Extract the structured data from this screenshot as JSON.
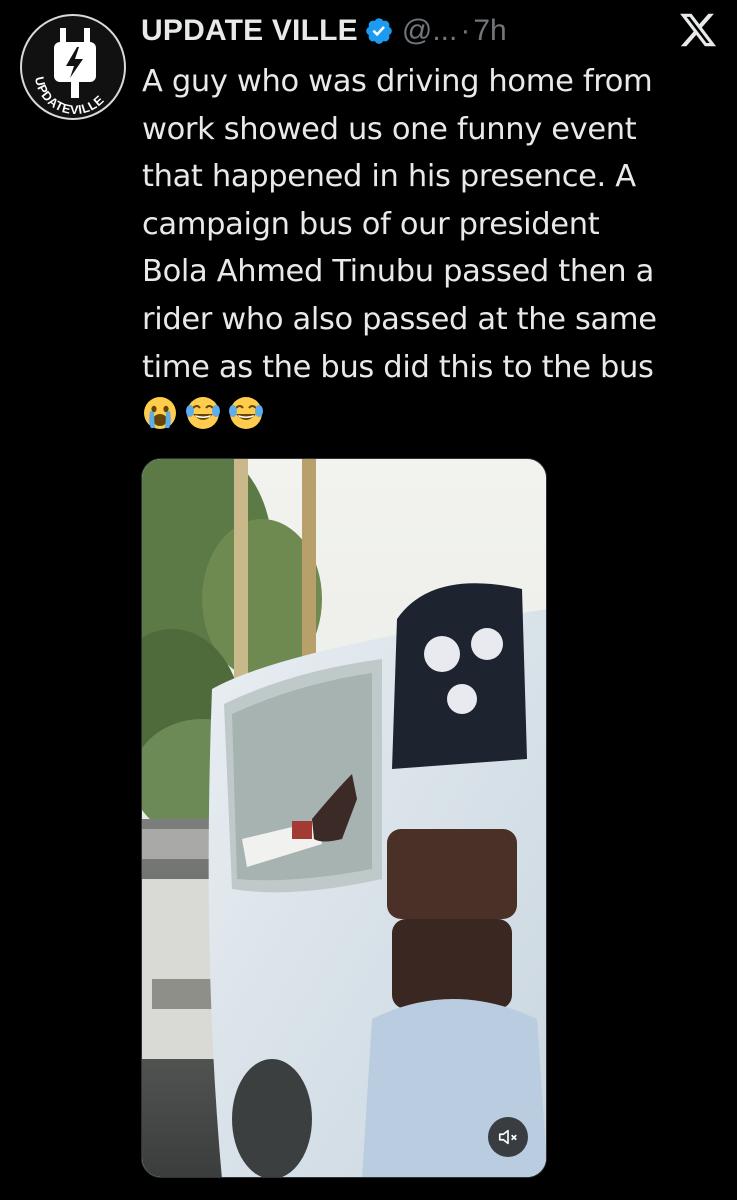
{
  "tweet": {
    "display_name": "UPDATE VILLE",
    "handle": "@...",
    "separator": "·",
    "time": "7h",
    "avatar_text": "UPDATEVILLE",
    "text": "A guy who was driving home from\nwork showed us one funny event\nthat happened in his presence. A\ncampaign bus of our president\nBola Ahmed Tinubu passed then a\nrider who also passed at the same\ntime as the bus did this to the bus",
    "emojis": [
      "face-crying-icon",
      "face-tears-of-joy-icon",
      "face-tears-of-joy-icon"
    ]
  },
  "icons": {
    "verified": "verified-badge-icon",
    "close": "x-logo-icon",
    "mute": "speaker-muted-icon"
  },
  "colors": {
    "background": "#000000",
    "text": "#e7e9ea",
    "secondary_text": "#71767b",
    "verified": "#1d9bf0"
  }
}
